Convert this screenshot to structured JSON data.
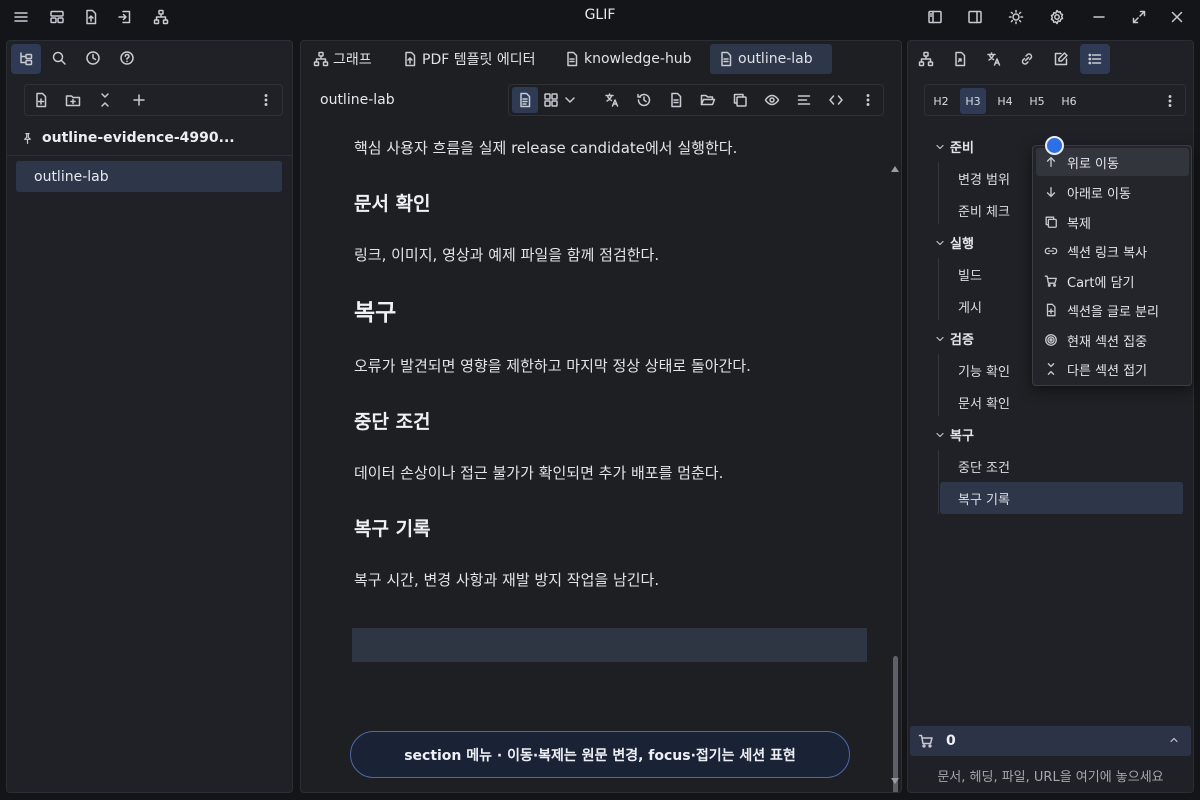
{
  "app": {
    "title": "GLIF"
  },
  "left": {
    "workspace_title": "outline-evidence-4990...",
    "documents": [
      "outline-lab"
    ]
  },
  "tabs": [
    {
      "label": "그래프",
      "icon": "graph-icon"
    },
    {
      "label": "PDF 템플릿 에디터",
      "icon": "file-export-icon"
    },
    {
      "label": "knowledge-hub",
      "icon": "document-icon"
    },
    {
      "label": "outline-lab",
      "icon": "document-icon",
      "active": true
    }
  ],
  "editor": {
    "doc_name": "outline-lab",
    "blocks": [
      {
        "type": "p",
        "text": "핵심 사용자 흐름을 실제 release candidate에서 실행한다."
      },
      {
        "type": "h4",
        "text": "문서 확인"
      },
      {
        "type": "p",
        "text": "링크, 이미지, 영상과 예제 파일을 함께 점검한다."
      },
      {
        "type": "h3",
        "text": "복구"
      },
      {
        "type": "p",
        "text": "오류가 발견되면 영향을 제한하고 마지막 정상 상태로 돌아간다."
      },
      {
        "type": "h4",
        "text": "중단 조건"
      },
      {
        "type": "p",
        "text": "데이터 손상이나 접근 불가가 확인되면 추가 배포를 멈춘다."
      },
      {
        "type": "h4",
        "text": "복구 기록"
      },
      {
        "type": "p",
        "text": "복구 시간, 변경 사항과 재발 방지 작업을 남긴다."
      }
    ],
    "hint": "section 메뉴 · 이동·복제는 원문 변경, focus·접기는 세션 표현"
  },
  "right": {
    "heading_levels": [
      "H2",
      "H3",
      "H4",
      "H5",
      "H6"
    ],
    "active_heading_level": "H3",
    "outline": [
      {
        "label": "준비",
        "children": [
          "변경 범위",
          "준비 체크"
        ]
      },
      {
        "label": "실행",
        "children": [
          "빌드",
          "게시"
        ]
      },
      {
        "label": "검증",
        "children": [
          "기능 확인",
          "문서 확인"
        ]
      },
      {
        "label": "복구",
        "children": [
          "중단 조건",
          "복구 기록"
        ]
      }
    ],
    "active_outline_item": "복구 기록",
    "cart_count": "0",
    "drop_hint": "문서, 헤딩, 파일, URL을 여기에 놓으세요"
  },
  "context_menu": {
    "items": [
      {
        "label": "위로 이동",
        "icon": "arrow-up-icon"
      },
      {
        "label": "아래로 이동",
        "icon": "arrow-down-icon"
      },
      {
        "label": "복제",
        "icon": "copy-icon"
      },
      {
        "label": "섹션 링크 복사",
        "icon": "link-icon"
      },
      {
        "label": "Cart에 담기",
        "icon": "cart-icon"
      },
      {
        "label": "섹션을 글로 분리",
        "icon": "file-plus-icon"
      },
      {
        "label": "현재 섹션 집중",
        "icon": "target-icon"
      },
      {
        "label": "다른 섹션 접기",
        "icon": "collapse-icon"
      }
    ]
  },
  "colors": {
    "accent": "#2f6fe6",
    "active_bg": "#2e3749",
    "panel_bg": "#202126",
    "app_bg": "#141518"
  }
}
